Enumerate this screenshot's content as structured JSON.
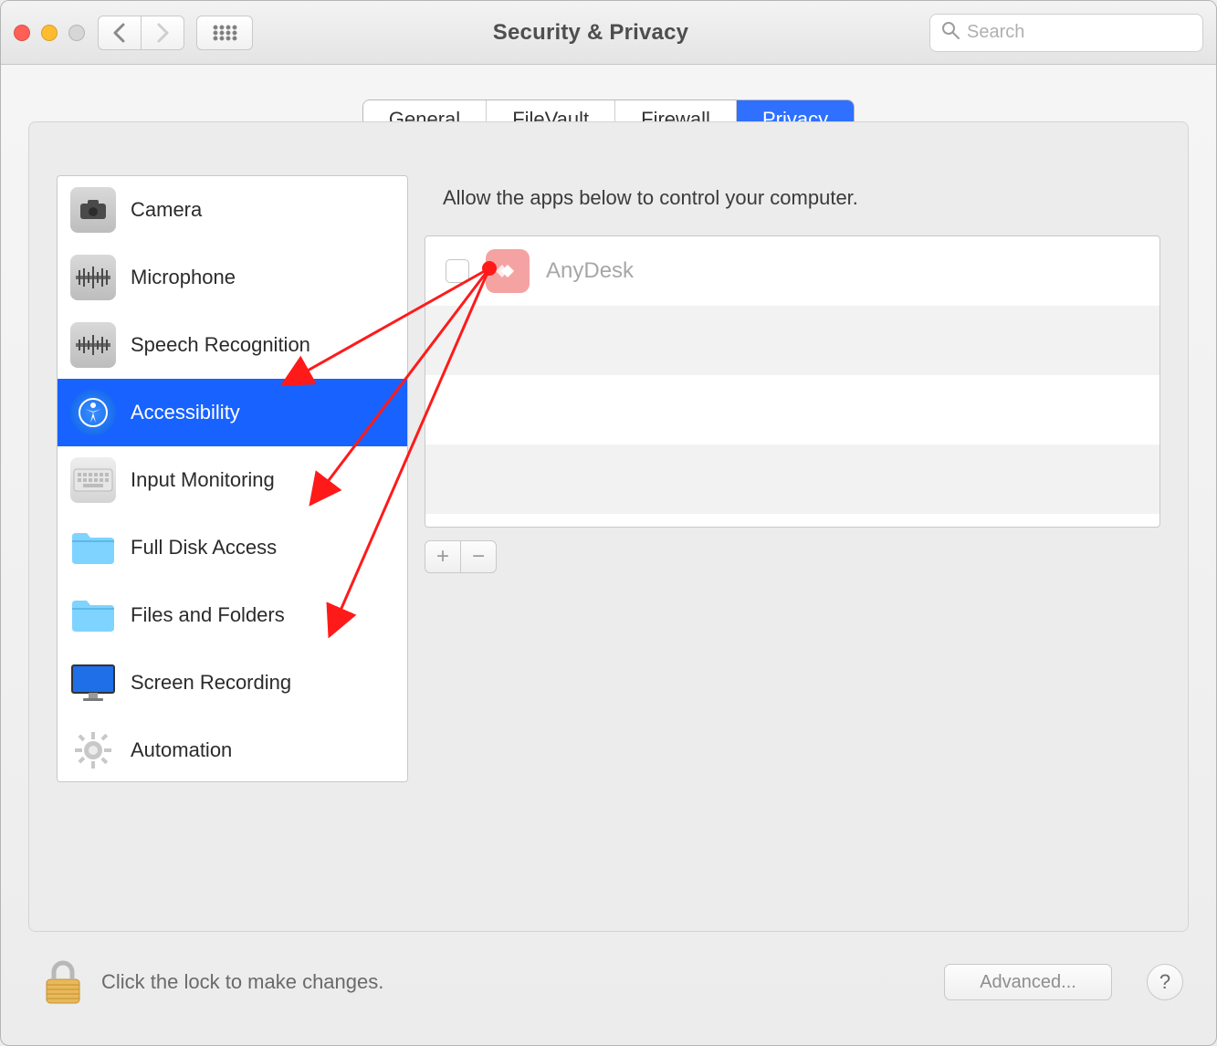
{
  "window": {
    "title": "Security & Privacy"
  },
  "search": {
    "placeholder": "Search"
  },
  "tabs": [
    {
      "label": "General",
      "active": false
    },
    {
      "label": "FileVault",
      "active": false
    },
    {
      "label": "Firewall",
      "active": false
    },
    {
      "label": "Privacy",
      "active": true
    }
  ],
  "sidebar": {
    "items": [
      {
        "label": "Camera",
        "icon": "camera-icon",
        "selected": false
      },
      {
        "label": "Microphone",
        "icon": "microphone-icon",
        "selected": false
      },
      {
        "label": "Speech Recognition",
        "icon": "speech-icon",
        "selected": false
      },
      {
        "label": "Accessibility",
        "icon": "accessibility-icon",
        "selected": true
      },
      {
        "label": "Input Monitoring",
        "icon": "keyboard-icon",
        "selected": false
      },
      {
        "label": "Full Disk Access",
        "icon": "folder-icon",
        "selected": false
      },
      {
        "label": "Files and Folders",
        "icon": "folder-icon",
        "selected": false
      },
      {
        "label": "Screen Recording",
        "icon": "display-icon",
        "selected": false
      },
      {
        "label": "Automation",
        "icon": "gear-icon",
        "selected": false
      }
    ]
  },
  "right": {
    "description": "Allow the apps below to control your computer.",
    "apps": [
      {
        "name": "AnyDesk",
        "checked": false,
        "icon_color": "#f39a99"
      }
    ],
    "add_label": "+",
    "remove_label": "−"
  },
  "footer": {
    "lock_text": "Click the lock to make changes.",
    "advanced_label": "Advanced...",
    "help_label": "?"
  },
  "colors": {
    "accent": "#1862ff",
    "anydesk": "#f39a99"
  }
}
